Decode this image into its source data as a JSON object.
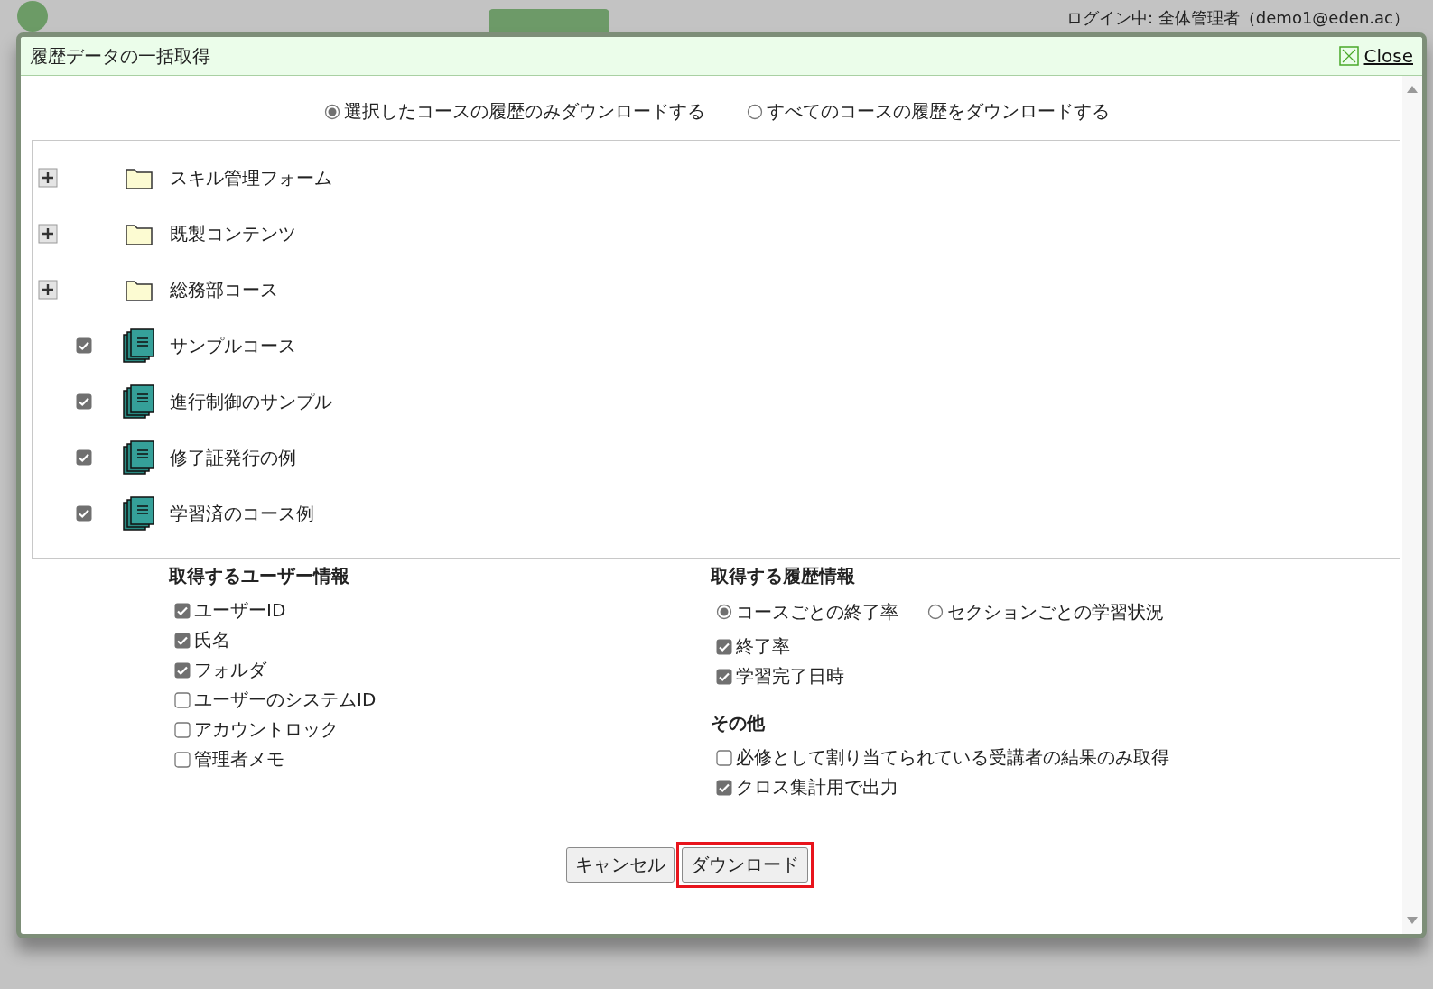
{
  "header": {
    "login": "ログイン中: 全体管理者（demo1@eden.ac）"
  },
  "dialog": {
    "title": "履歴データの一括取得",
    "close": "Close"
  },
  "scope_options": [
    {
      "label": "選択したコースの履歴のみダウンロードする",
      "selected": true
    },
    {
      "label": "すべてのコースの履歴をダウンロードする",
      "selected": false
    }
  ],
  "tree": [
    {
      "kind": "folder",
      "label": "スキル管理フォーム"
    },
    {
      "kind": "folder",
      "label": "既製コンテンツ"
    },
    {
      "kind": "folder",
      "label": "総務部コース"
    },
    {
      "kind": "course",
      "label": "サンプルコース",
      "checked": true
    },
    {
      "kind": "course",
      "label": "進行制御のサンプル",
      "checked": true
    },
    {
      "kind": "course",
      "label": "修了証発行の例",
      "checked": true
    },
    {
      "kind": "course",
      "label": "学習済のコース例",
      "checked": true
    }
  ],
  "user_info": {
    "heading": "取得するユーザー情報",
    "options": [
      {
        "label": "ユーザーID",
        "checked": true
      },
      {
        "label": "氏名",
        "checked": true
      },
      {
        "label": "フォルダ",
        "checked": true
      },
      {
        "label": "ユーザーのシステムID",
        "checked": false
      },
      {
        "label": "アカウントロック",
        "checked": false
      },
      {
        "label": "管理者メモ",
        "checked": false
      }
    ]
  },
  "history_info": {
    "heading": "取得する履歴情報",
    "modes": [
      {
        "label": "コースごとの終了率",
        "selected": true
      },
      {
        "label": "セクションごとの学習状況",
        "selected": false
      }
    ],
    "options": [
      {
        "label": "終了率",
        "checked": true
      },
      {
        "label": "学習完了日時",
        "checked": true
      }
    ]
  },
  "other": {
    "heading": "その他",
    "options": [
      {
        "label": "必修として割り当てられている受講者の結果のみ取得",
        "checked": false
      },
      {
        "label": "クロス集計用で出力",
        "checked": true
      }
    ]
  },
  "buttons": [
    {
      "label": "キャンセル",
      "highlighted": false
    },
    {
      "label": "ダウンロード",
      "highlighted": true
    }
  ]
}
